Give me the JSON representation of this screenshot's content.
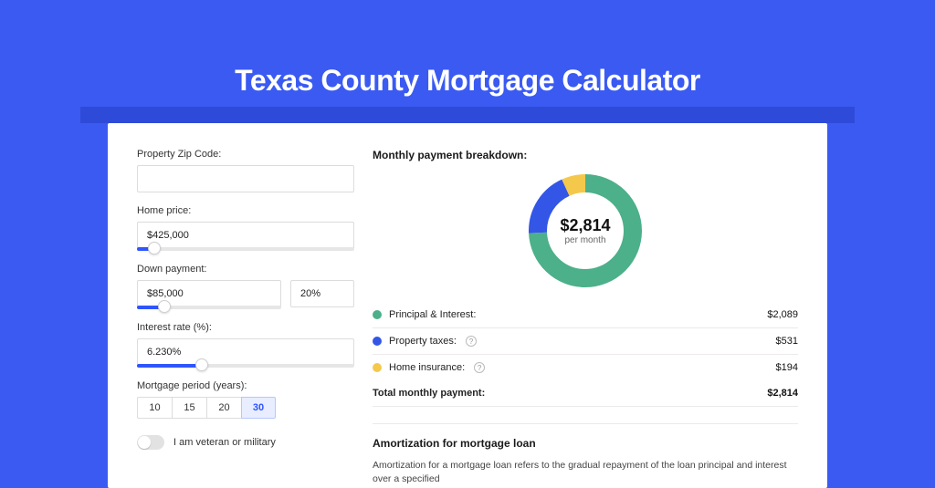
{
  "title": "Texas County Mortgage Calculator",
  "form": {
    "zip_label": "Property Zip Code:",
    "zip_value": "",
    "home_price_label": "Home price:",
    "home_price_value": "$425,000",
    "down_payment_label": "Down payment:",
    "down_payment_value": "$85,000",
    "down_payment_pct": "20%",
    "interest_label": "Interest rate (%):",
    "interest_value": "6.230%",
    "period_label": "Mortgage period (years):",
    "periods": [
      "10",
      "15",
      "20",
      "30"
    ],
    "period_selected": "30",
    "veteran_label": "I am veteran or military"
  },
  "sliders": {
    "home_price_fill_pct": 8,
    "down_payment_fill_pct": 19,
    "interest_fill_pct": 30
  },
  "breakdown": {
    "title": "Monthly payment breakdown:",
    "center_amount": "$2,814",
    "center_sub": "per month",
    "items": [
      {
        "label": "Principal & Interest:",
        "value": "$2,089",
        "color": "#4cb08a",
        "has_info": false
      },
      {
        "label": "Property taxes:",
        "value": "$531",
        "color": "#3356e6",
        "has_info": true
      },
      {
        "label": "Home insurance:",
        "value": "$194",
        "color": "#f4c94b",
        "has_info": true
      }
    ],
    "total_label": "Total monthly payment:",
    "total_value": "$2,814"
  },
  "chart_data": {
    "type": "pie",
    "title": "Monthly payment breakdown",
    "series": [
      {
        "name": "Principal & Interest",
        "value": 2089,
        "color": "#4cb08a"
      },
      {
        "name": "Property taxes",
        "value": 531,
        "color": "#3356e6"
      },
      {
        "name": "Home insurance",
        "value": 194,
        "color": "#f4c94b"
      }
    ],
    "total": 2814
  },
  "amortization": {
    "heading": "Amortization for mortgage loan",
    "body": "Amortization for a mortgage loan refers to the gradual repayment of the loan principal and interest over a specified"
  }
}
